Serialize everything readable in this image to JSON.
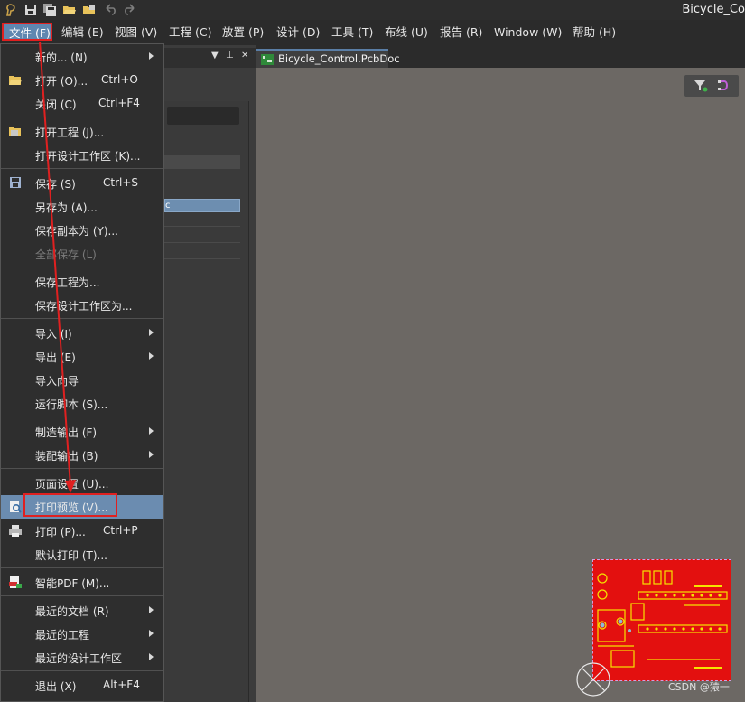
{
  "window": {
    "title": "Bicycle_Co"
  },
  "toolbar_icons": [
    "app-logo-icon",
    "save-icon",
    "save-all-icon",
    "open-folder-icon",
    "open-project-icon",
    "undo-icon",
    "redo-icon"
  ],
  "menubar": {
    "file": "文件 (F)",
    "edit": "编辑 (E)",
    "view": "视图 (V)",
    "project": "工程 (C)",
    "place": "放置 (P)",
    "design": "设计 (D)",
    "tools": "工具 (T)",
    "route": "布线 (U)",
    "reports": "报告 (R)",
    "window": "Window (W)",
    "help": "帮助 (H)"
  },
  "panel": {
    "selected_item_text": "c"
  },
  "document_tab": {
    "label": "Bicycle_Control.PcbDoc"
  },
  "file_menu": {
    "new": {
      "label": "新的... (N)"
    },
    "open": {
      "label": "打开 (O)...",
      "shortcut": "Ctrl+O"
    },
    "close": {
      "label": "关闭 (C)",
      "shortcut": "Ctrl+F4"
    },
    "open_project": {
      "label": "打开工程 (J)..."
    },
    "open_workspace": {
      "label": "打开设计工作区 (K)..."
    },
    "save": {
      "label": "保存 (S)",
      "shortcut": "Ctrl+S"
    },
    "save_as": {
      "label": "另存为 (A)..."
    },
    "save_copy_as": {
      "label": "保存副本为 (Y)..."
    },
    "save_all": {
      "label": "全部保存 (L)"
    },
    "save_project_as": {
      "label": "保存工程为..."
    },
    "save_workspace_as": {
      "label": "保存设计工作区为..."
    },
    "import": {
      "label": "导入 (I)"
    },
    "export": {
      "label": "导出 (E)"
    },
    "import_wizard": {
      "label": "导入向导"
    },
    "run_script": {
      "label": "运行脚本 (S)..."
    },
    "fab_outputs": {
      "label": "制造输出 (F)"
    },
    "assembly_outputs": {
      "label": "装配输出 (B)"
    },
    "page_setup": {
      "label": "页面设置 (U)..."
    },
    "print_preview": {
      "label": "打印预览 (V)..."
    },
    "print": {
      "label": "打印 (P)...",
      "shortcut": "Ctrl+P"
    },
    "default_print": {
      "label": "默认打印 (T)..."
    },
    "smart_pdf": {
      "label": "智能PDF (M)..."
    },
    "recent_docs": {
      "label": "最近的文档 (R)"
    },
    "recent_projects": {
      "label": "最近的工程"
    },
    "recent_workspaces": {
      "label": "最近的设计工作区"
    },
    "exit": {
      "label": "退出 (X)",
      "shortcut": "Alt+F4"
    }
  },
  "pcb_preview": {
    "board_color": "#e3100f",
    "trace_color": "#f5e400"
  },
  "watermark": {
    "text": "CSDN @猿一"
  },
  "colors": {
    "highlight": "#6b8cb0",
    "annotation_red": "#e02020"
  }
}
